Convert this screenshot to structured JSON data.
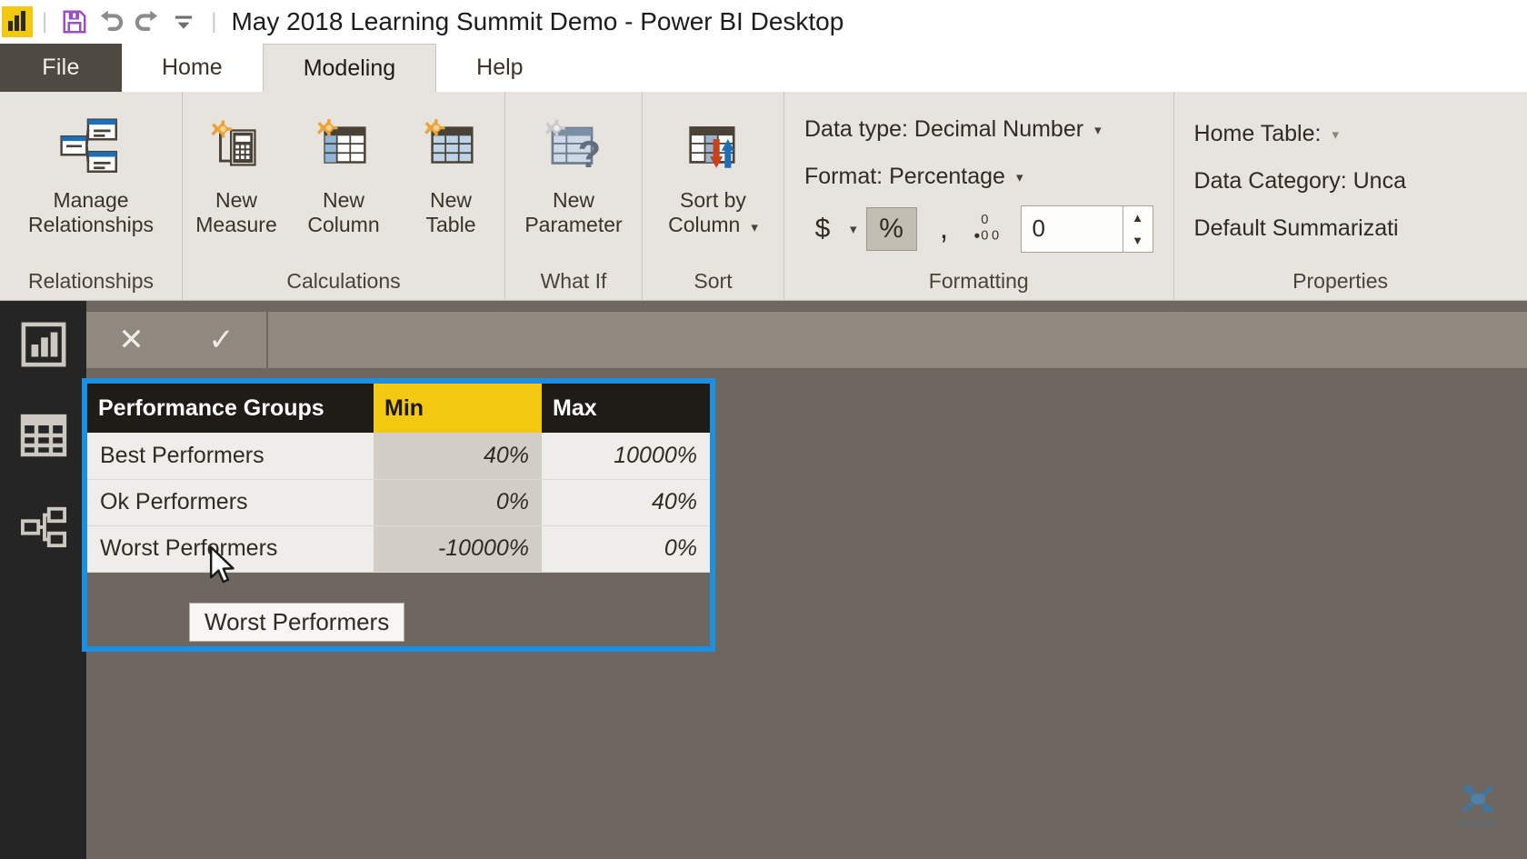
{
  "titlebar": {
    "app_icon": "power-bi-logo",
    "save_icon": "save-icon",
    "undo_icon": "undo-icon",
    "redo_icon": "redo-icon",
    "customize_icon": "customize-quick-access-icon",
    "title": "May 2018 Learning Summit Demo - Power BI Desktop"
  },
  "tabs": [
    {
      "label": "File",
      "active": false
    },
    {
      "label": "Home",
      "active": false
    },
    {
      "label": "Modeling",
      "active": true
    },
    {
      "label": "Help",
      "active": false
    }
  ],
  "ribbon": {
    "groups": [
      {
        "label": "Relationships",
        "buttons": [
          {
            "label": "Manage\nRelationships",
            "line1": "Manage",
            "line2": "Relationships",
            "icon": "manage-relationships-icon"
          }
        ]
      },
      {
        "label": "Calculations",
        "buttons": [
          {
            "line1": "New",
            "line2": "Measure",
            "icon": "new-measure-icon"
          },
          {
            "line1": "New",
            "line2": "Column",
            "icon": "new-column-icon"
          },
          {
            "line1": "New",
            "line2": "Table",
            "icon": "new-table-icon"
          }
        ]
      },
      {
        "label": "What If",
        "buttons": [
          {
            "line1": "New",
            "line2": "Parameter",
            "icon": "new-parameter-icon"
          }
        ]
      },
      {
        "label": "Sort",
        "buttons": [
          {
            "line1": "Sort by",
            "line2": "Column",
            "icon": "sort-by-column-icon",
            "has_caret": true
          }
        ]
      },
      {
        "label": "Formatting",
        "data_type_label": "Data type: Decimal Number",
        "format_label": "Format: Percentage",
        "currency_symbol": "$",
        "percent_symbol": "%",
        "comma_symbol": ",",
        "decimal_places_icon": "decimal-places-icon",
        "decimal_places_value": "0"
      },
      {
        "label": "Properties",
        "home_table_label": "Home Table:",
        "data_category_label": "Data Category: Unca",
        "default_summarization_label": "Default Summarizati"
      }
    ]
  },
  "leftrail": {
    "items": [
      {
        "name": "report-view",
        "icon": "bar-chart-icon"
      },
      {
        "name": "data-view",
        "icon": "table-grid-icon"
      },
      {
        "name": "model-view",
        "icon": "relationships-icon"
      }
    ]
  },
  "formula_bar": {
    "cancel_icon": "cancel-icon",
    "accept_icon": "accept-icon",
    "value": ""
  },
  "grid": {
    "columns": [
      {
        "header": "Performance Groups",
        "selected": false,
        "align": "left"
      },
      {
        "header": "Min",
        "selected": true,
        "align": "right"
      },
      {
        "header": "Max",
        "selected": false,
        "align": "right"
      }
    ],
    "rows": [
      {
        "name": "Best Performers",
        "min": "40%",
        "max": "10000%"
      },
      {
        "name": "Ok Performers",
        "min": "0%",
        "max": "40%"
      },
      {
        "name": "Worst Performers",
        "min": "-10000%",
        "max": "0%"
      }
    ]
  },
  "tooltip": {
    "text": "Worst Performers"
  },
  "cursor": {
    "icon": "mouse-pointer-icon"
  },
  "watermark": {
    "text": "SUBSCRIBE",
    "icon": "channel-logo-icon"
  },
  "colors": {
    "accent_yellow": "#f2c811",
    "selection_blue": "#1a8fe3",
    "header_black": "#1f1c18",
    "ribbon_bg": "#e7e4df",
    "canvas_bg": "#6e675f"
  }
}
